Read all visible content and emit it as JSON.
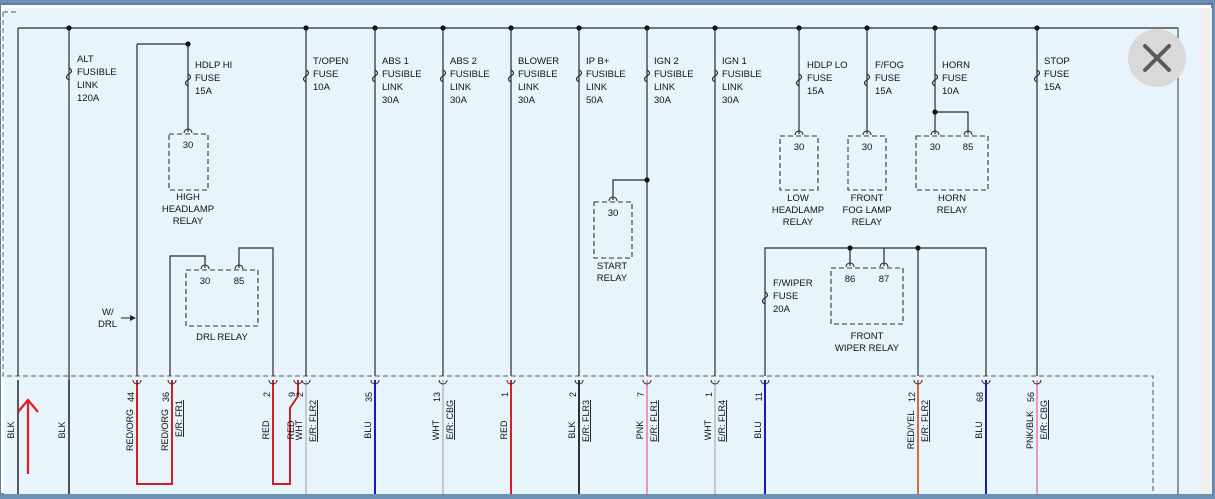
{
  "fuses": [
    {
      "id": "alt",
      "lines": [
        "ALT",
        "FUSIBLE",
        "LINK",
        "120A"
      ]
    },
    {
      "id": "hdlp-hi",
      "lines": [
        "HDLP HI",
        "FUSE",
        "15A"
      ]
    },
    {
      "id": "t-open",
      "lines": [
        "T/OPEN",
        "FUSE",
        "10A"
      ]
    },
    {
      "id": "abs1",
      "lines": [
        "ABS 1",
        "FUSIBLE",
        "LINK",
        "30A"
      ]
    },
    {
      "id": "abs2",
      "lines": [
        "ABS 2",
        "FUSIBLE",
        "LINK",
        "30A"
      ]
    },
    {
      "id": "blower",
      "lines": [
        "BLOWER",
        "FUSIBLE",
        "LINK",
        "30A"
      ]
    },
    {
      "id": "ip-b",
      "lines": [
        "IP B+",
        "FUSIBLE",
        "LINK",
        "50A"
      ]
    },
    {
      "id": "ign2",
      "lines": [
        "IGN 2",
        "FUSIBLE",
        "LINK",
        "30A"
      ]
    },
    {
      "id": "ign1",
      "lines": [
        "IGN 1",
        "FUSIBLE",
        "LINK",
        "30A"
      ]
    },
    {
      "id": "hdlp-lo",
      "lines": [
        "HDLP LO",
        "FUSE",
        "15A"
      ]
    },
    {
      "id": "f-fog",
      "lines": [
        "F/FOG",
        "FUSE",
        "15A"
      ]
    },
    {
      "id": "horn",
      "lines": [
        "HORN",
        "FUSE",
        "10A"
      ]
    },
    {
      "id": "stop",
      "lines": [
        "STOP",
        "FUSE",
        "15A"
      ]
    },
    {
      "id": "f-wiper",
      "lines": [
        "F/WIPER",
        "FUSE",
        "20A"
      ]
    }
  ],
  "relays": [
    {
      "id": "high-headlamp",
      "pins": [
        "30"
      ],
      "name": [
        "HIGH",
        "HEADLAMP",
        "RELAY"
      ]
    },
    {
      "id": "drl",
      "pins": [
        "30",
        "85"
      ],
      "name": [
        "DRL RELAY"
      ]
    },
    {
      "id": "start",
      "pins": [
        "30"
      ],
      "name": [
        "START",
        "RELAY"
      ]
    },
    {
      "id": "low-headlamp",
      "pins": [
        "30"
      ],
      "name": [
        "LOW",
        "HEADLAMP",
        "RELAY"
      ]
    },
    {
      "id": "front-fog",
      "pins": [
        "30"
      ],
      "name": [
        "FRONT",
        "FOG LAMP",
        "RELAY"
      ]
    },
    {
      "id": "horn",
      "pins": [
        "30",
        "85"
      ],
      "name": [
        "HORN",
        "RELAY"
      ]
    },
    {
      "id": "front-wiper",
      "pins": [
        "86",
        "87"
      ],
      "name": [
        "FRONT",
        "WIPER RELAY"
      ]
    }
  ],
  "drl_note": [
    "W/",
    "DRL"
  ],
  "wires": [
    {
      "color": "BLK",
      "pin": "",
      "conn": ""
    },
    {
      "color": "BLK",
      "pin": "",
      "conn": ""
    },
    {
      "color": "RED/ORG",
      "pin": "44",
      "conn": ""
    },
    {
      "color": "RED/ORG",
      "pin": "36",
      "conn": "E/R: FR1"
    },
    {
      "color": "RED",
      "pin": "2",
      "conn": ""
    },
    {
      "color": "RED",
      "pin": "9",
      "conn": ""
    },
    {
      "color": "WHT",
      "pin": "2",
      "conn": "E/R: FLR2"
    },
    {
      "color": "BLU",
      "pin": "35",
      "conn": ""
    },
    {
      "color": "WHT",
      "pin": "13",
      "conn": "E/R: CBG"
    },
    {
      "color": "RED",
      "pin": "1",
      "conn": ""
    },
    {
      "color": "BLK",
      "pin": "2",
      "conn": "E/R: FLR3"
    },
    {
      "color": "PNK",
      "pin": "7",
      "conn": "E/R: FLR1"
    },
    {
      "color": "WHT",
      "pin": "1",
      "conn": "E/R: FLR4"
    },
    {
      "color": "BLU",
      "pin": "11",
      "conn": ""
    },
    {
      "color": "RED/YEL",
      "pin": "12",
      "conn": "E/R: FLR2"
    },
    {
      "color": "BLU",
      "pin": "68",
      "conn": ""
    },
    {
      "color": "PNK/BLK",
      "pin": "56",
      "conn": "E/R: CBG"
    }
  ],
  "colors": {
    "window_bg": "#6b8fb5",
    "panel_bg": "#e8f4fb",
    "line": "#2a2a2a",
    "red_wire": "#d42020",
    "blue_wire": "#1a1ab4",
    "pink_wire": "#e89ab0",
    "white_wire": "#c8c8c8",
    "black_wire": "#333333",
    "red_yel_wire": "#d66a3a",
    "arrow": "#e02020"
  },
  "close_icon": "close-x-icon"
}
